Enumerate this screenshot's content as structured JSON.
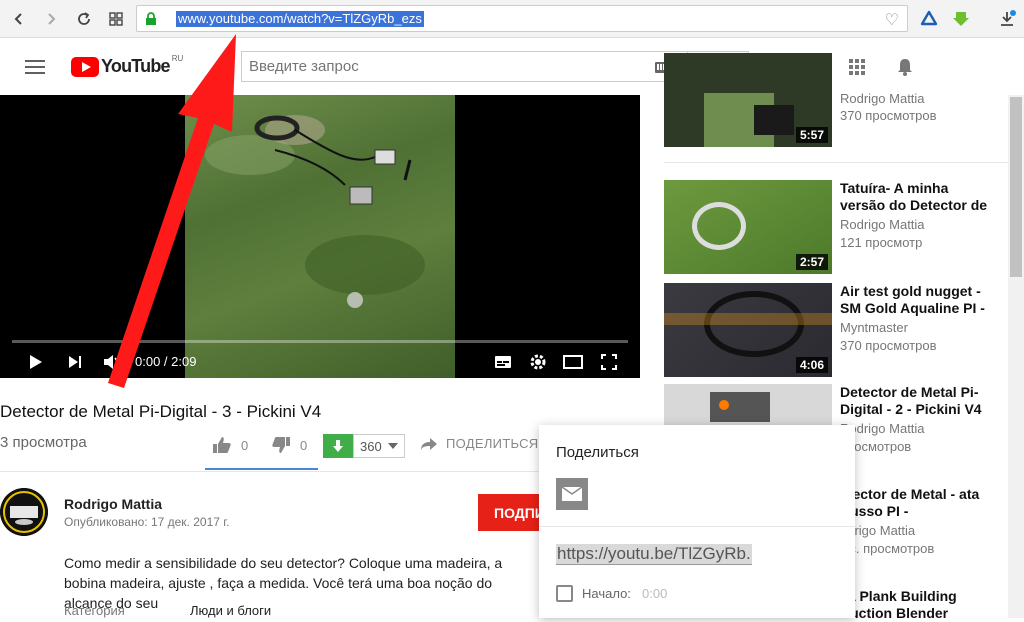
{
  "browser": {
    "url": "www.youtube.com/watch?v=TlZGyRb_ezs"
  },
  "header": {
    "logo_text": "YouTube",
    "logo_region": "RU",
    "search_placeholder": "Введите запрос"
  },
  "player": {
    "time": "0:00 / 2:09",
    "progress": 0
  },
  "video": {
    "title": "Detector de Metal Pi-Digital - 3 - Pickini V4",
    "views": "3 просмотра",
    "likes": "0",
    "dislikes": "0",
    "download_count": "360",
    "share_label": "ПОДЕЛИТЬСЯ"
  },
  "channel": {
    "name": "Rodrigo Mattia",
    "published": "Опубликовано: 17 дек. 2017 г.",
    "subscribe_label": "ПОДПИ",
    "description": "Como medir a sensibilidade do seu detector? Coloque uma madeira, a bobina madeira,  ajuste , faça a medida. Você terá uma boa noção do alcance do seu",
    "category_label": "Категория",
    "category_value": "Люди и блоги"
  },
  "related": [
    {
      "title": "",
      "channel": "Rodrigo Mattia",
      "views": "370 просмотров",
      "duration": "5:57"
    },
    {
      "title": "Tatuíra- A minha versão do Detector de",
      "channel": "Rodrigo Mattia",
      "views": "121 просмотр",
      "duration": "2:57"
    },
    {
      "title": "Air test gold nugget - SM Gold Aqualine PI -",
      "channel": "Myntmaster",
      "views": "370 просмотров",
      "duration": "4:06"
    },
    {
      "title": "Detector de Metal Pi-Digital - 2 - Pickini V4",
      "channel": "Rodrigo Mattia",
      "views": "просмотров",
      "duration": ""
    },
    {
      "title": "etector de Metal - ata Russo PI -",
      "channel": "odrigo Mattia",
      "views": "ыс. просмотров",
      "duration": ""
    },
    {
      "title": "va Plank Building truction Blender",
      "channel": "",
      "views": "",
      "duration": ""
    }
  ],
  "share_popup": {
    "title": "Поделиться",
    "short_url": "https://youtu.be/TlZGyRb.",
    "start_label": "Начало:",
    "start_time": "0:00"
  },
  "colors": {
    "accent_red": "#ff0000",
    "subscribe_red": "#e62117",
    "download_green": "#3fae49",
    "selection_blue": "#3b73d9",
    "annotation_arrow": "#ff1a1a"
  }
}
